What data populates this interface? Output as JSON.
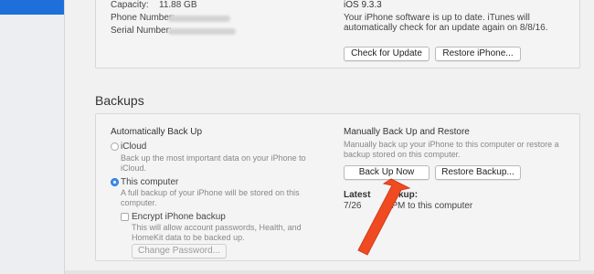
{
  "summary": {
    "capacity_label": "Capacity:",
    "capacity_value": "11.88 GB",
    "phone_label": "Phone Number:",
    "serial_label": "Serial Number:",
    "ios_version": "iOS 9.3.3",
    "update_status": "Your iPhone software is up to date. iTunes will automatically check for an update again on 8/8/16.",
    "check_update_button": "Check for Update",
    "restore_iphone_button": "Restore iPhone..."
  },
  "backups": {
    "section_title": "Backups",
    "auto_title": "Automatically Back Up",
    "icloud_label": "iCloud",
    "icloud_desc": "Back up the most important data on your iPhone to iCloud.",
    "computer_label": "This computer",
    "computer_desc": "A full backup of your iPhone will be stored on this computer.",
    "selected_option": "This computer",
    "encrypt_label": "Encrypt iPhone backup",
    "encrypt_checked": false,
    "encrypt_desc": "This will allow account passwords, Health, and HomeKit data to be backed up.",
    "change_password_button": "Change Password...",
    "manual_title": "Manually Back Up and Restore",
    "manual_desc": "Manually back up your iPhone to this computer or restore a backup stored on this computer.",
    "back_up_now_button": "Back Up Now",
    "restore_backup_button": "Restore Backup...",
    "latest_backup_label": "Latest",
    "latest_backup_label_tail": "kup:",
    "latest_backup_value": "7/26",
    "latest_backup_value_tail": "8 PM to this computer"
  },
  "colors": {
    "accent": "#1e6fd9",
    "arrow": "#f04a23"
  }
}
